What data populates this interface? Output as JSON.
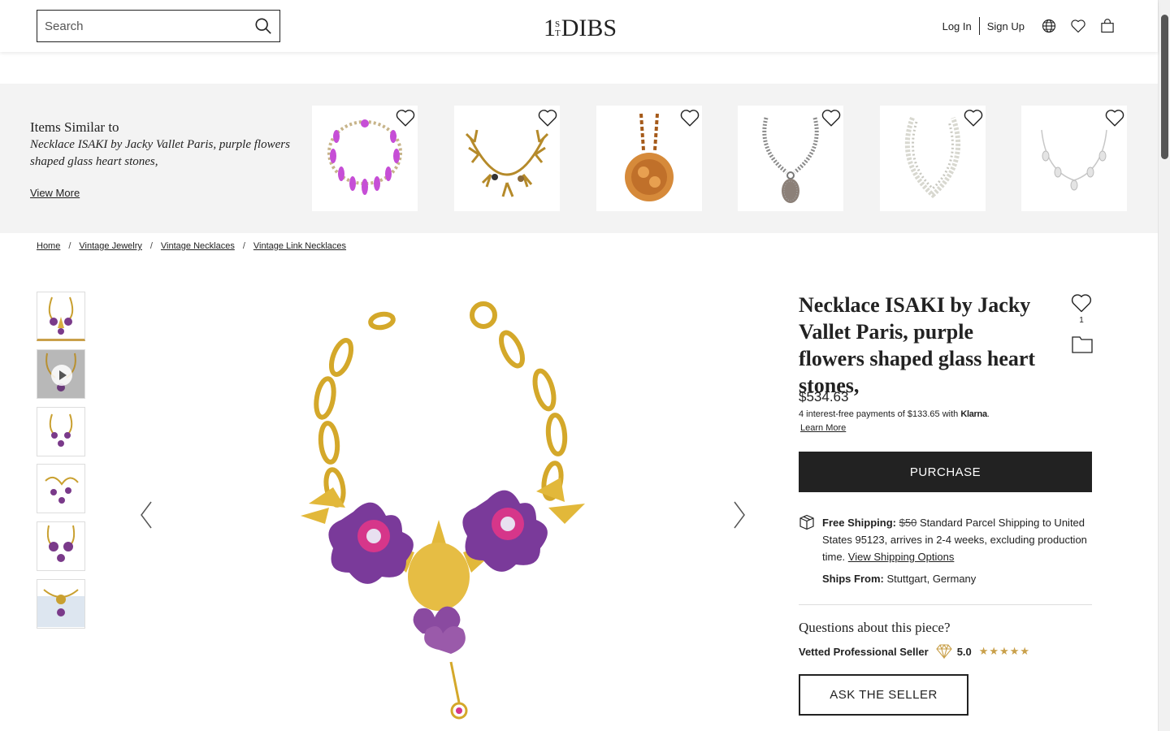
{
  "header": {
    "search_placeholder": "Search",
    "logo_one": "1",
    "logo_s": "S",
    "logo_t": "T",
    "logo_dibs": "DIBS",
    "login_label": "Log In",
    "signup_label": "Sign Up",
    "icons": [
      "search-icon",
      "globe-icon",
      "heart-icon",
      "bag-icon"
    ]
  },
  "similar": {
    "heading": "Items Similar to",
    "subheading": "Necklace ISAKI by Jacky Vallet Paris, purple flowers shaped glass heart stones,",
    "view_more": "View More"
  },
  "breadcrumb": {
    "items": [
      "Home",
      "Vintage Jewelry",
      "Vintage Necklaces",
      "Vintage Link Necklaces"
    ],
    "separator": "/"
  },
  "product": {
    "title": "Necklace ISAKI by Jacky Vallet Paris, purple flowers shaped glass heart stones,",
    "favorite_count": "1",
    "price": "$534.63",
    "klarna_prefix": "4 interest-free payments of $133.65 with ",
    "klarna_brand": "Klarna",
    "klarna_suffix": ".",
    "learn_more": "Learn More",
    "purchase_label": "PURCHASE",
    "shipping_label": "Free Shipping:",
    "shipping_strike": "$50",
    "shipping_text": " Standard Parcel Shipping to United States 95123, arrives in 2-4 weeks, excluding production time. ",
    "shipping_link": "View Shipping Options",
    "ships_from_label": "Ships From:",
    "ships_from_value": " Stuttgart, Germany",
    "questions": "Questions about this piece?",
    "vetted_label": "Vetted Professional Seller",
    "rating": "5.0",
    "stars": "★★★★★",
    "rating_value": 5,
    "ask_label": "ASK THE SELLER"
  },
  "colors": {
    "accent_gold": "#c9a04a",
    "button_dark": "#222222",
    "strip_bg": "#f3f3f3"
  }
}
